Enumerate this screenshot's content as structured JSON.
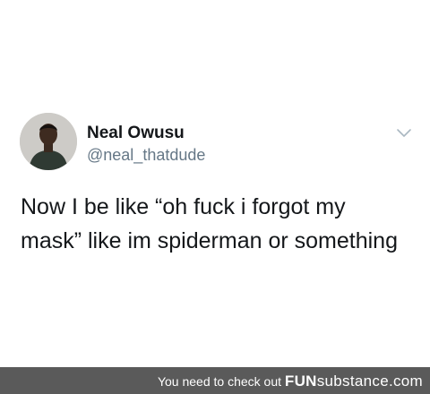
{
  "tweet": {
    "author": {
      "display_name": "Neal Owusu",
      "handle": "@neal_thatdude"
    },
    "text_lines": [
      "Now I be like “oh fuck i forgot my",
      "mask” like im spiderman or something"
    ],
    "more_icon": "chevron-down-icon"
  },
  "footer": {
    "prefix": "You need to check out ",
    "brand_part1": "FUN",
    "brand_part2": "substance",
    "brand_suffix": ".com"
  },
  "colors": {
    "background": "#ffffff",
    "text": "#14171a",
    "handle": "#657786",
    "chevron": "#aab8c2",
    "footer_bg": "#5a5a5a",
    "footer_text": "#ffffff"
  }
}
